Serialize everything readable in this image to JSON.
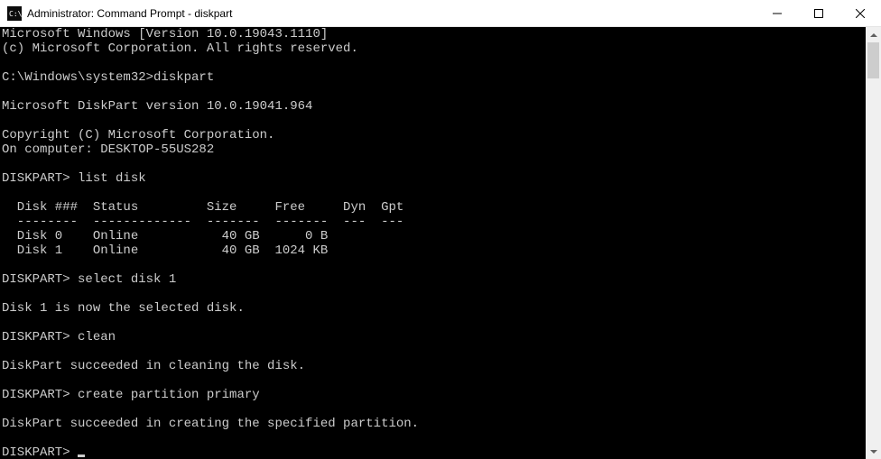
{
  "window": {
    "title": "Administrator: Command Prompt - diskpart"
  },
  "terminal": {
    "lines": [
      "Microsoft Windows [Version 10.0.19043.1110]",
      "(c) Microsoft Corporation. All rights reserved.",
      "",
      "C:\\Windows\\system32>diskpart",
      "",
      "Microsoft DiskPart version 10.0.19041.964",
      "",
      "Copyright (C) Microsoft Corporation.",
      "On computer: DESKTOP-55US282",
      "",
      "DISKPART> list disk",
      "",
      "  Disk ###  Status         Size     Free     Dyn  Gpt",
      "  --------  -------------  -------  -------  ---  ---",
      "  Disk 0    Online           40 GB      0 B",
      "  Disk 1    Online           40 GB  1024 KB",
      "",
      "DISKPART> select disk 1",
      "",
      "Disk 1 is now the selected disk.",
      "",
      "DISKPART> clean",
      "",
      "DiskPart succeeded in cleaning the disk.",
      "",
      "DISKPART> create partition primary",
      "",
      "DiskPart succeeded in creating the specified partition.",
      "",
      "DISKPART> "
    ]
  }
}
